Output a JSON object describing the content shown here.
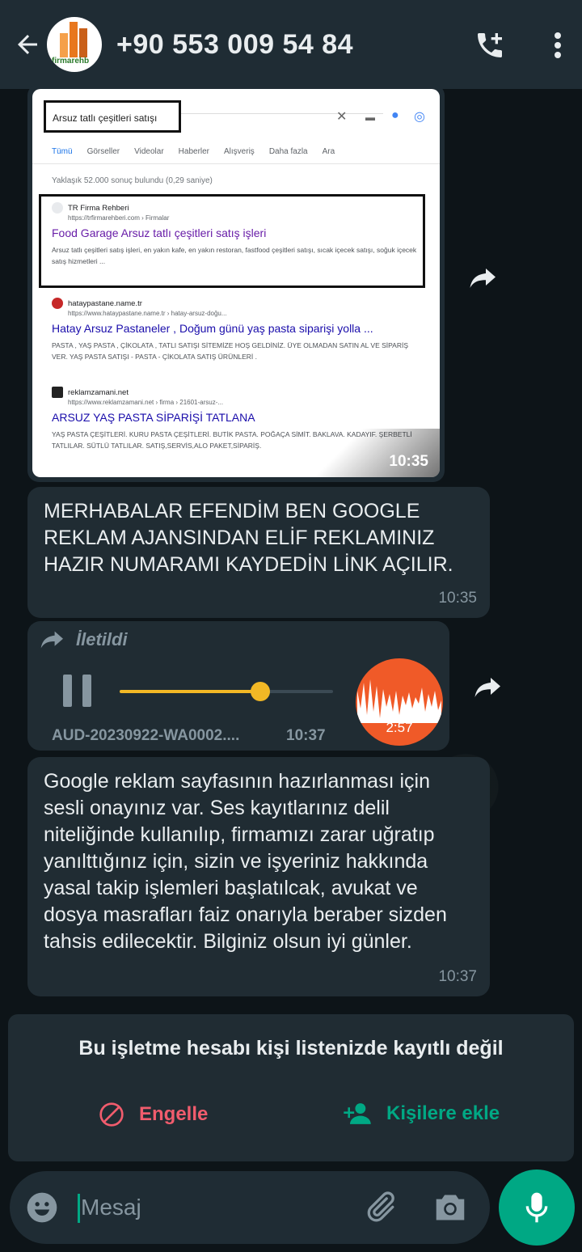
{
  "header": {
    "avatar_text": "firmarehb",
    "phone": "+90 553 009 54 84",
    "icons": [
      "back-arrow-icon",
      "add-call-icon",
      "more-vert-icon"
    ]
  },
  "image_message": {
    "search_query": "Arsuz tatlı çeşitleri satışı",
    "tabs": [
      "Tümü",
      "Görseller",
      "Videolar",
      "Haberler",
      "Alışveriş",
      "Daha fazla",
      "Ara"
    ],
    "results_count": "Yaklaşık 52.000 sonuç bulundu (0,29 saniye)",
    "results": [
      {
        "site": "TR Firma Rehberi",
        "url": "https://trfirmarehberi.com › Firmalar",
        "title": "Food Garage Arsuz tatlı çeşitleri satış işleri",
        "desc": "Arsuz tatlı çeşitleri satış işleri, en yakın kafe, en yakın restoran, fastfood çeşitleri satışı, sıcak içecek satışı, soğuk içecek satış hizmetleri ..."
      },
      {
        "site": "hataypastane.name.tr",
        "url": "https://www.hataypastane.name.tr › hatay-arsuz-doğu...",
        "title": "Hatay Arsuz Pastaneler , Doğum günü yaş pasta siparişi yolla ...",
        "desc": "PASTA , YAŞ PASTA , ÇİKOLATA , TATLI SATIŞI SİTEMİZE HOŞ GELDİNİZ. ÜYE OLMADAN SATIN AL VE SİPARİŞ VER. YAŞ PASTA SATIŞI - PASTA - ÇİKOLATA SATIŞ ÜRÜNLERİ ."
      },
      {
        "site": "reklamzamani.net",
        "url": "https://www.reklamzamani.net › firma › 21601-arsuz-...",
        "title": "ARSUZ YAŞ PASTA SİPARİŞİ TATLANA",
        "desc": "YAŞ PASTA ÇEŞİTLERİ. KURU PASTA ÇEŞİTLERİ. BUTİK PASTA. POĞAÇA SİMİT. BAKLAVA. KADAYIF. ŞERBETLİ TATLILAR. SÜTLÜ TATLILAR. SATIŞ,SERVİS,ALO PAKET,SİPARİŞ."
      }
    ],
    "time": "10:35"
  },
  "messages": [
    {
      "text": "MERHABALAR EFENDİM BEN GOOGLE REKLAM AJANSINDAN ELİF REKLAMINIZ HAZIR NUMARAMI KAYDEDİN LİNK AÇILIR.",
      "time": "10:35"
    },
    {
      "text": "Google reklam sayfasının hazırlanması için sesli onayınız var. Ses kayıtlarınız delil niteliğinde kullanılıp, firmamızı zarar uğratıp yanılttığınız için, sizin ve işyeriniz hakkında yasal takip işlemleri başlatılcak, avukat ve dosya masrafları faiz onarıyla beraber sizden tahsis edilecektir. Bilginiz olsun iyi günler.",
      "time": "10:37"
    }
  ],
  "audio_message": {
    "forwarded_label": "İletildi",
    "filename": "AUD-20230922-WA0002....",
    "time": "10:37",
    "duration": "2:57",
    "progress": 0.66,
    "accent_color": "#f2b825"
  },
  "business_notice": {
    "title": "Bu işletme hesabı kişi listenizde kayıtlı değil",
    "block_label": "Engelle",
    "add_label": "Kişilere ekle"
  },
  "composer": {
    "placeholder": "Mesaj"
  },
  "colors": {
    "header_bg": "#1f2c34",
    "bubble_bg": "#202c33",
    "accent_green": "#00a884",
    "block_red": "#f15c6d"
  }
}
